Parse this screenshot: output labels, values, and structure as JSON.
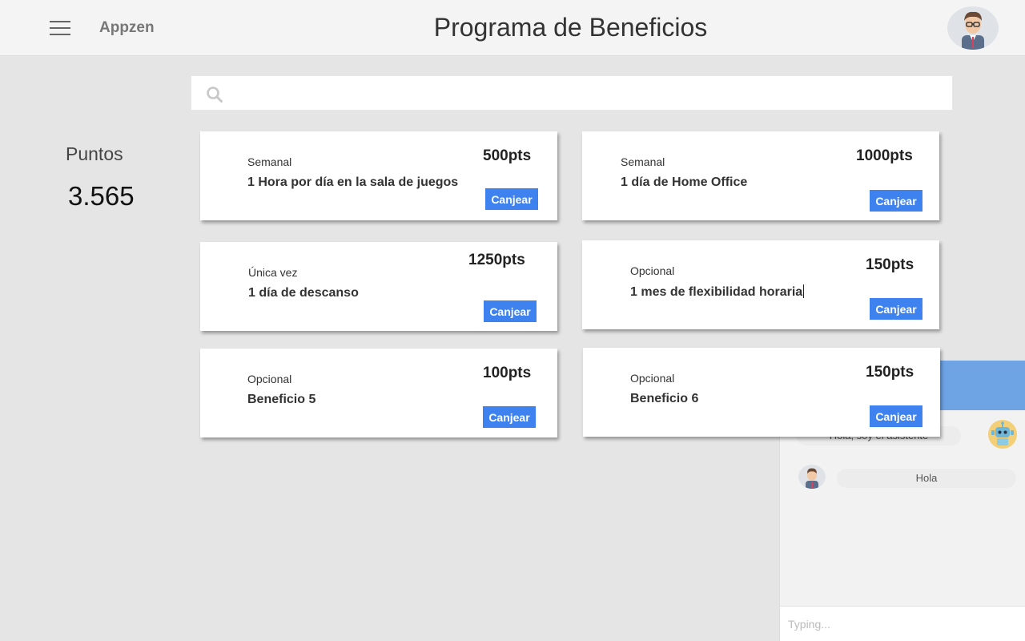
{
  "header": {
    "brand": "Appzen",
    "title": "Programa de Beneficios"
  },
  "search": {
    "value": "",
    "placeholder": ""
  },
  "points": {
    "label": "Puntos",
    "value": "3.565"
  },
  "cards": [
    {
      "frequency": "Semanal",
      "title": "1 Hora por día en la sala de juegos",
      "points": "500pts",
      "button": "Canjear"
    },
    {
      "frequency": "Semanal",
      "title": "1 día de Home Office",
      "points": "1000pts",
      "button": "Canjear"
    },
    {
      "frequency": "Única vez",
      "title": "1 día de descanso",
      "points": "1250pts",
      "button": "Canjear"
    },
    {
      "frequency": "Opcional",
      "title": "1 mes de flexibilidad horaria",
      "points": "150pts",
      "button": "Canjear"
    },
    {
      "frequency": "Opcional",
      "title": "Beneficio 5",
      "points": "100pts",
      "button": "Canjear"
    },
    {
      "frequency": "Opcional",
      "title": "Beneficio 6",
      "points": "150pts",
      "button": "Canjear"
    }
  ],
  "chat": {
    "messages": [
      {
        "from": "bot",
        "text": "Hola, soy el asistente"
      },
      {
        "from": "user",
        "text": "Hola"
      }
    ],
    "input_placeholder": "Typing..."
  },
  "colors": {
    "accent": "#3d82ee",
    "chat_header": "#6ea3e4",
    "background": "#e5e5e5"
  }
}
